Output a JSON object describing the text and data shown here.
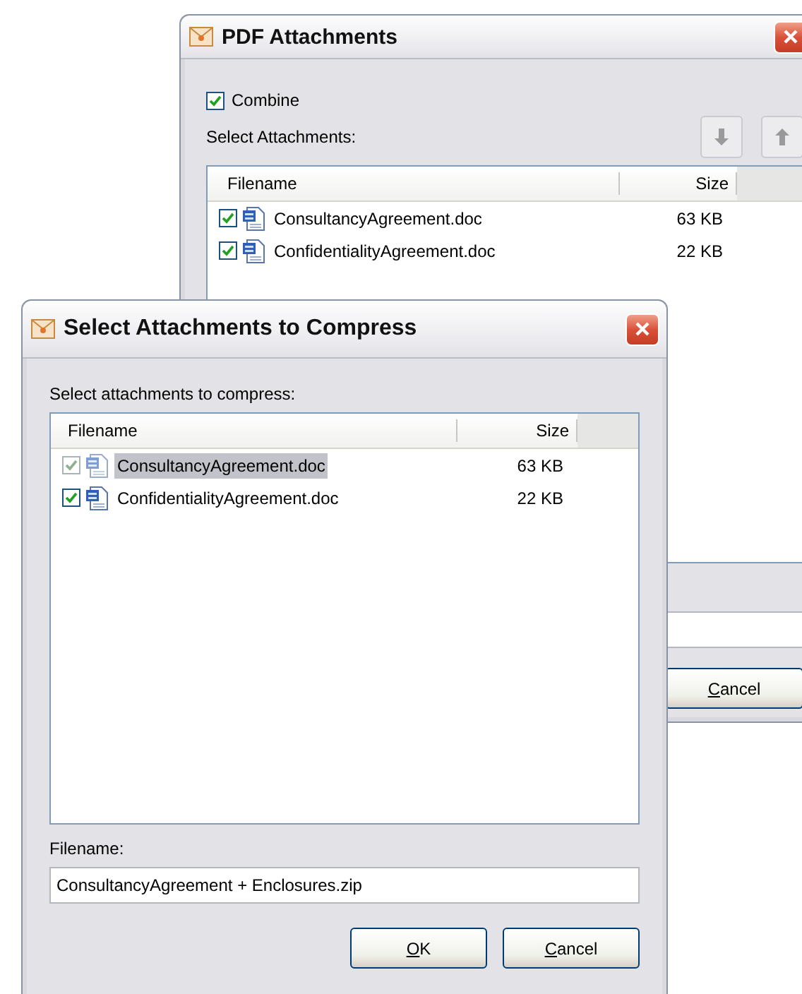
{
  "back_window": {
    "title": "PDF Attachments",
    "combine": {
      "label": "Combine",
      "checked": true
    },
    "list_label": "Select Attachments:",
    "columns": [
      "Filename",
      "Size"
    ],
    "rows": [
      {
        "filename": "ConsultancyAgreement.doc",
        "size": "63 KB",
        "checked": true,
        "selected": false
      },
      {
        "filename": "ConfidentialityAgreement.doc",
        "size": "22 KB",
        "checked": true,
        "selected": false
      }
    ],
    "cancel_button": {
      "label": "Cancel",
      "underline_first": true
    }
  },
  "front_window": {
    "title": "Select Attachments to Compress",
    "list_label": "Select attachments to compress:",
    "columns": [
      "Filename",
      "Size"
    ],
    "rows": [
      {
        "filename": "ConsultancyAgreement.doc",
        "size": "63 KB",
        "checked": true,
        "disabled": true,
        "selected": true
      },
      {
        "filename": "ConfidentialityAgreement.doc",
        "size": "22 KB",
        "checked": true,
        "disabled": false,
        "selected": false
      }
    ],
    "filename_label": "Filename:",
    "filename_value": "ConsultancyAgreement + Enclosures.zip",
    "buttons": [
      {
        "label": "OK",
        "underline_first": true
      },
      {
        "label": "Cancel",
        "underline_first": true
      }
    ]
  }
}
